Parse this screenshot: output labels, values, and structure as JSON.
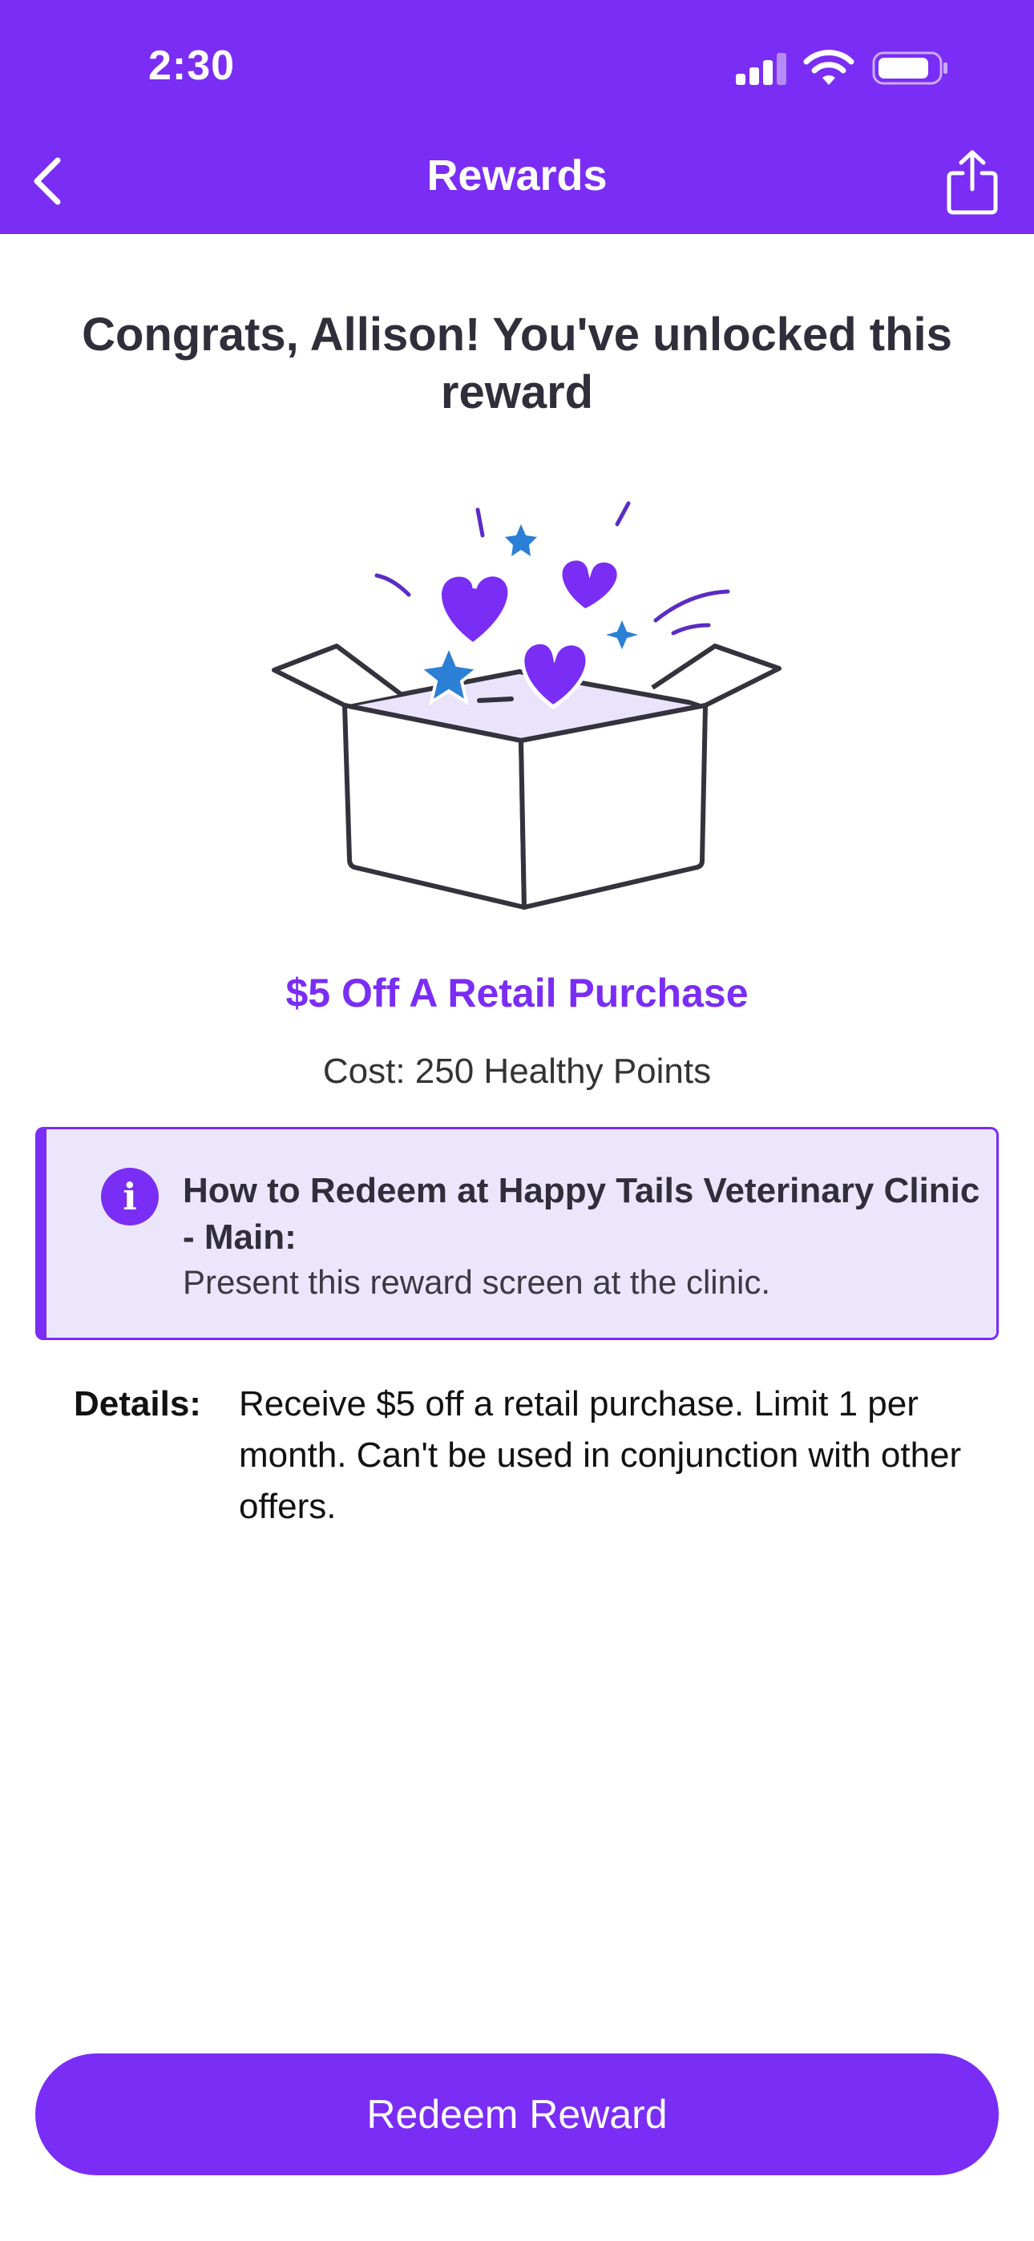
{
  "status_bar": {
    "time": "2:30",
    "icons": [
      "cellular-signal-icon",
      "wifi-icon",
      "battery-icon"
    ]
  },
  "nav": {
    "title": "Rewards",
    "back_icon": "chevron-left-icon",
    "share_icon": "share-icon"
  },
  "colors": {
    "brand": "#7a2df5",
    "info_box_bg": "#ece6fd",
    "heading_text": "#2f2e3a",
    "star_blue": "#2b7fd4"
  },
  "headline": "Congrats, Allison! You've unlocked this reward",
  "illustration": {
    "icon": "open-gift-box-with-hearts-icon"
  },
  "reward": {
    "title": "$5 Off A Retail Purchase",
    "cost": "Cost: 250 Healthy Points"
  },
  "redeem_info": {
    "icon": "info-icon",
    "icon_glyph": "i",
    "heading": "How to Redeem at Happy Tails Veterinary Clinic - Main:",
    "text": "Present this reward screen at the clinic."
  },
  "details": {
    "label": "Details:",
    "text": "Receive $5 off a retail purchase. Limit 1 per month. Can't be used in conjunction with other offers."
  },
  "cta": {
    "label": "Redeem Reward"
  }
}
